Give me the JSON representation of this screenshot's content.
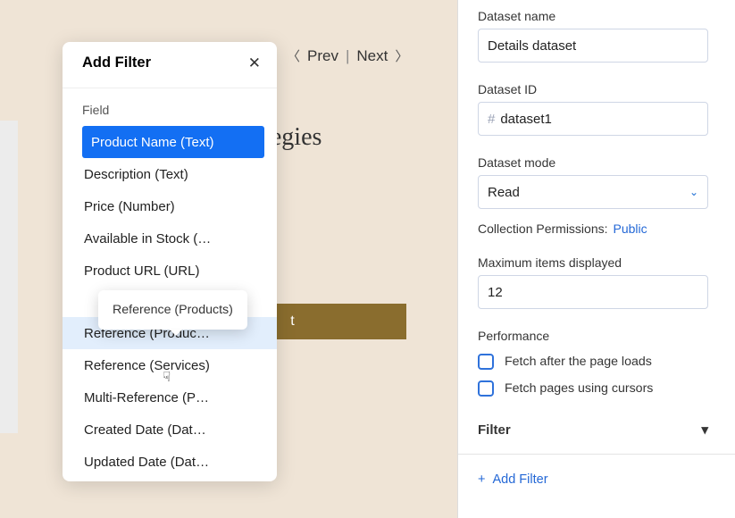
{
  "canvas": {
    "heading": "Strategies",
    "button": "t",
    "nav_prev": "Prev",
    "nav_next": "Next"
  },
  "panel": {
    "dataset_name_label": "Dataset name",
    "dataset_name_value": "Details dataset",
    "dataset_id_label": "Dataset ID",
    "dataset_id_value": "dataset1",
    "dataset_mode_label": "Dataset mode",
    "dataset_mode_value": "Read",
    "collection_permissions_label": "Collection Permissions:",
    "collection_permissions_value": "Public",
    "max_items_label": "Maximum items displayed",
    "max_items_value": "12",
    "performance_label": "Performance",
    "fetch_after": "Fetch after the page loads",
    "fetch_cursors": "Fetch pages using cursors",
    "filter_section": "Filter",
    "add_filter": "Add Filter"
  },
  "popup": {
    "title": "Add Filter",
    "field_label": "Field",
    "tooltip": "Reference (Products)",
    "items": [
      "Product Name (Text)",
      "Description (Text)",
      "Price (Number)",
      "Available in Stock (…",
      "Product URL (URL)"
    ],
    "items2": [
      "Reference (Produc…",
      "Reference (Services)",
      "Multi-Reference (P…",
      "Created Date (Dat…",
      "Updated Date (Dat…"
    ]
  }
}
